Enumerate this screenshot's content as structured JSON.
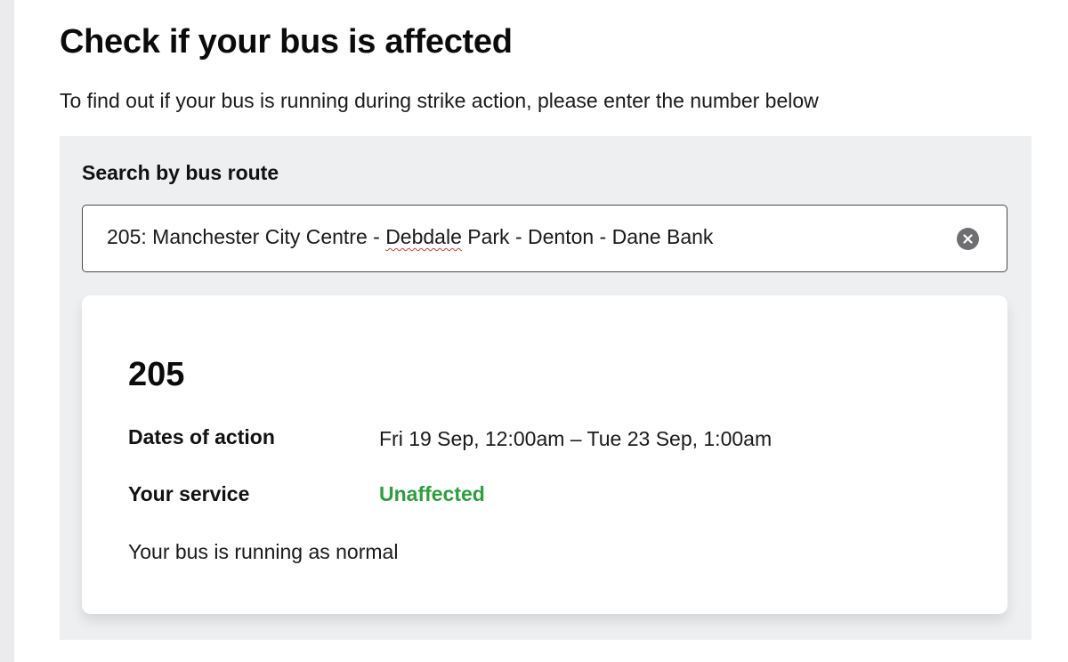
{
  "page": {
    "title": "Check if your bus is affected",
    "intro": "To find out if your bus is running during strike action, please enter the number below"
  },
  "search": {
    "label": "Search by bus route",
    "value_prefix": "205: Manchester City Centre - ",
    "value_flagged": "Debdale",
    "value_suffix": " Park - Denton - Dane Bank",
    "clear_icon": "close-circle-icon"
  },
  "result": {
    "route": "205",
    "dates_label": "Dates of action",
    "dates_value": "Fri 19 Sep, 12:00am – Tue 23 Sep, 1:00am",
    "service_label": "Your service",
    "service_status": "Unaffected",
    "message": "Your bus is running as normal"
  },
  "colors": {
    "status_unaffected": "#2e9e3e",
    "panel_bg": "#eeeff1",
    "clear_button": "#6f6f72"
  }
}
